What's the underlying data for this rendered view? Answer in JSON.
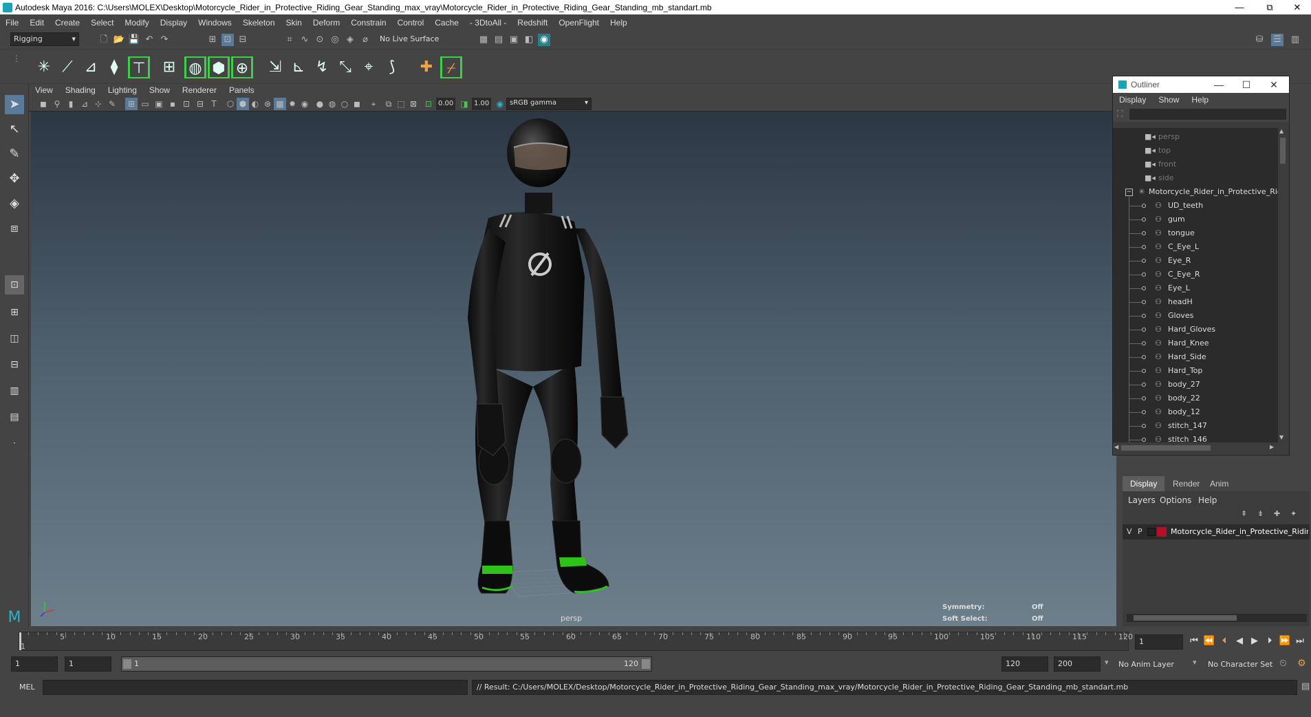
{
  "window": {
    "title": "Autodesk Maya 2016: C:\\Users\\MOLEX\\Desktop\\Motorcycle_Rider_in_Protective_Riding_Gear_Standing_max_vray\\Motorcycle_Rider_in_Protective_Riding_Gear_Standing_mb_standart.mb",
    "controls": [
      "—",
      "⧉",
      "✕"
    ]
  },
  "menubar": [
    "File",
    "Edit",
    "Create",
    "Select",
    "Modify",
    "Display",
    "Windows",
    "Skeleton",
    "Skin",
    "Deform",
    "Constrain",
    "Control",
    "Cache",
    "- 3DtoAll -",
    "Redshift",
    "OpenFlight",
    "Help"
  ],
  "statusline": {
    "menuset": "Rigging",
    "live_surface": "No Live Surface"
  },
  "viewport": {
    "menus": [
      "View",
      "Shading",
      "Lighting",
      "Show",
      "Renderer",
      "Panels"
    ],
    "exposure": "0.00",
    "gamma": "1.00",
    "color_space": "sRGB gamma",
    "camera_label": "persp",
    "symmetry_label": "Symmetry:",
    "symmetry_value": "Off",
    "soft_select_label": "Soft Select:",
    "soft_select_value": "Off"
  },
  "outliner": {
    "title": "Outliner",
    "menus": [
      "Display",
      "Show",
      "Help"
    ],
    "cameras": [
      "persp",
      "top",
      "front",
      "side"
    ],
    "root": "Motorcycle_Rider_in_Protective_Rid",
    "children": [
      "UD_teeth",
      "gum",
      "tongue",
      "C_Eye_L",
      "Eye_R",
      "C_Eye_R",
      "Eye_L",
      "headH",
      "Gloves",
      "Hard_Gloves",
      "Hard_Knee",
      "Hard_Side",
      "Hard_Top",
      "body_27",
      "body_22",
      "body_12",
      "stitch_147",
      "stitch_146"
    ]
  },
  "layers": {
    "tabs": [
      "Display",
      "Render",
      "Anim"
    ],
    "active_tab": "Display",
    "menus": [
      "Layers",
      "Options",
      "Help"
    ],
    "layer": {
      "v": "V",
      "p": "P",
      "name": "Motorcycle_Rider_in_Protective_Ridir",
      "color": "#b3112a"
    }
  },
  "timeline": {
    "ticks": [
      5,
      10,
      15,
      20,
      25,
      30,
      35,
      40,
      45,
      50,
      55,
      60,
      65,
      70,
      75,
      80,
      85,
      90,
      95,
      100,
      105,
      110,
      115,
      120
    ],
    "start_label": "1",
    "current_frame": "1"
  },
  "range": {
    "start": "1",
    "playback_start": "1",
    "slider_start": "1",
    "slider_end": "120",
    "playback_end": "120",
    "end": "200",
    "anim_layer": "No Anim Layer",
    "character_set": "No Character Set"
  },
  "command": {
    "lang": "MEL",
    "result": "// Result: C:/Users/MOLEX/Desktop/Motorcycle_Rider_in_Protective_Riding_Gear_Standing_max_vray/Motorcycle_Rider_in_Protective_Riding_Gear_Standing_mb_standart.mb"
  },
  "colors": {
    "accent_green": "#3fd04a",
    "maya_teal": "#1aa3b8",
    "layer_red": "#b3112a"
  }
}
